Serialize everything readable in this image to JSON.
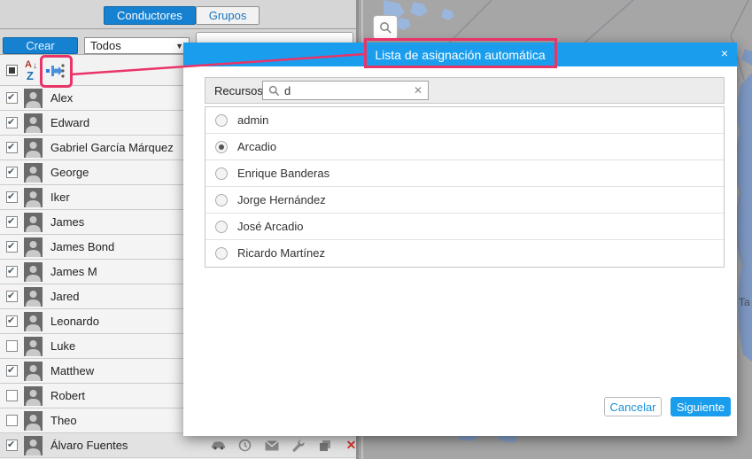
{
  "colors": {
    "accent_blue": "#1a9ded",
    "tab_blue": "#1581d0",
    "annotation_pink": "#e93467",
    "map_water": "#7e99c4"
  },
  "panel": {
    "tabs": [
      {
        "label": "Conductores",
        "active": true
      },
      {
        "label": "Grupos",
        "active": false
      }
    ],
    "create_button": "Crear",
    "filter_dropdown_value": "Todos",
    "toolbar_icons": [
      "select-all-checkbox",
      "sort-az-icon",
      "auto-assignment-icon"
    ],
    "sort_icon": {
      "a": "A",
      "z": "Z",
      "arrow": "↓"
    },
    "row_action_icons": [
      "vehicle-icon",
      "clock-icon",
      "message-icon",
      "wrench-icon",
      "copy-icon",
      "delete-icon"
    ],
    "drivers": [
      {
        "name": "Alex",
        "checked": true
      },
      {
        "name": "Edward",
        "checked": true
      },
      {
        "name": "Gabriel García Márquez",
        "checked": true
      },
      {
        "name": "George",
        "checked": true
      },
      {
        "name": "Iker",
        "checked": true
      },
      {
        "name": "James",
        "checked": true
      },
      {
        "name": "James Bond",
        "checked": true
      },
      {
        "name": "James M",
        "checked": true
      },
      {
        "name": "Jared",
        "checked": true
      },
      {
        "name": "Leonardo",
        "checked": true
      },
      {
        "name": "Luke",
        "checked": false
      },
      {
        "name": "Matthew",
        "checked": true
      },
      {
        "name": "Robert",
        "checked": false
      },
      {
        "name": "Theo",
        "checked": false
      },
      {
        "name": "Álvaro Fuentes",
        "checked": true,
        "hover": true,
        "delete_glyph": "✕"
      }
    ]
  },
  "modal": {
    "title": "Lista de asignación automática",
    "close_glyph": "×",
    "resources_label": "Recursos",
    "search_value": "d",
    "search_clear_glyph": "✕",
    "options": [
      {
        "label": "admin",
        "selected": false
      },
      {
        "label": "Arcadio",
        "selected": true
      },
      {
        "label": "Enrique Banderas",
        "selected": false
      },
      {
        "label": "Jorge Hernández",
        "selected": false
      },
      {
        "label": "José Arcadio",
        "selected": false
      },
      {
        "label": "Ricardo Martínez",
        "selected": false
      }
    ],
    "cancel_button": "Cancelar",
    "next_button": "Siguiente"
  },
  "map": {
    "partial_label": "Ta"
  },
  "dropdown_caret": "▼"
}
